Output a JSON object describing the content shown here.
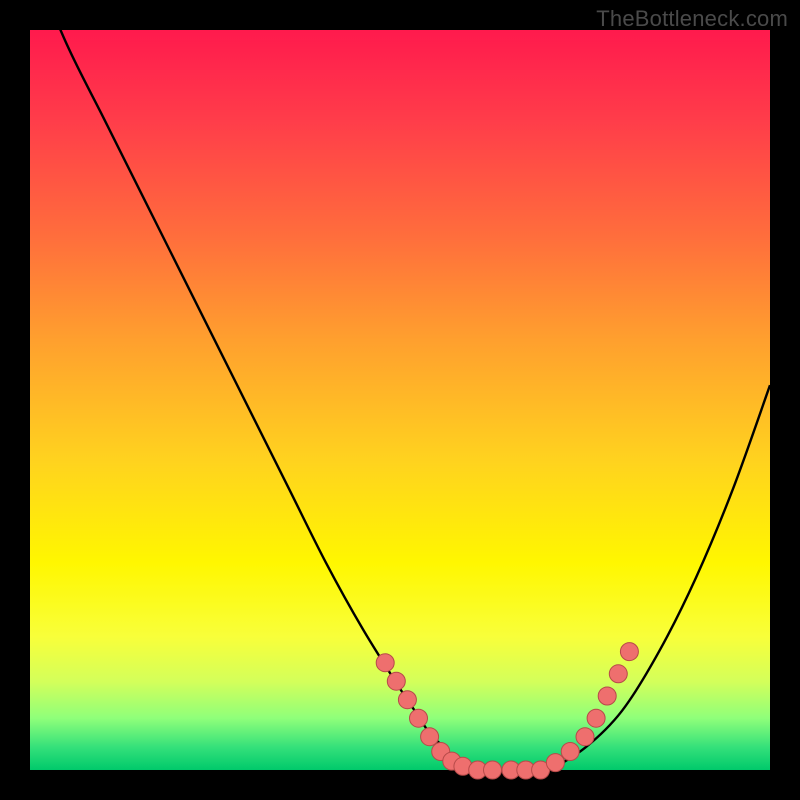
{
  "watermark": "TheBottleneck.com",
  "colors": {
    "frame": "#000000",
    "curve": "#000000",
    "dot_fill": "#ee6f6e",
    "dot_stroke": "#b64a49"
  },
  "chart_data": {
    "type": "line",
    "title": "",
    "xlabel": "",
    "ylabel": "",
    "xlim": [
      0,
      100
    ],
    "ylim": [
      0,
      100
    ],
    "series": [
      {
        "name": "bottleneck-curve",
        "x": [
          0,
          5,
          10,
          15,
          20,
          25,
          30,
          35,
          40,
          45,
          50,
          52,
          54,
          56,
          58,
          60,
          62,
          64,
          66,
          68,
          70,
          75,
          80,
          85,
          90,
          95,
          100
        ],
        "y": [
          110,
          98,
          88,
          78,
          68,
          58,
          48,
          38,
          28,
          19,
          11,
          8,
          5,
          3,
          1,
          0,
          0,
          0,
          0,
          0,
          0,
          3,
          8,
          16,
          26,
          38,
          52
        ]
      }
    ],
    "highlight_dots": {
      "name": "pink-dots",
      "points": [
        {
          "x": 48,
          "y": 14.5
        },
        {
          "x": 49.5,
          "y": 12
        },
        {
          "x": 51,
          "y": 9.5
        },
        {
          "x": 52.5,
          "y": 7
        },
        {
          "x": 54,
          "y": 4.5
        },
        {
          "x": 55.5,
          "y": 2.5
        },
        {
          "x": 57,
          "y": 1.2
        },
        {
          "x": 58.5,
          "y": 0.5
        },
        {
          "x": 60.5,
          "y": 0
        },
        {
          "x": 62.5,
          "y": 0
        },
        {
          "x": 65,
          "y": 0
        },
        {
          "x": 67,
          "y": 0
        },
        {
          "x": 69,
          "y": 0
        },
        {
          "x": 71,
          "y": 1
        },
        {
          "x": 73,
          "y": 2.5
        },
        {
          "x": 75,
          "y": 4.5
        },
        {
          "x": 76.5,
          "y": 7
        },
        {
          "x": 78,
          "y": 10
        },
        {
          "x": 79.5,
          "y": 13
        },
        {
          "x": 81,
          "y": 16
        }
      ]
    }
  }
}
